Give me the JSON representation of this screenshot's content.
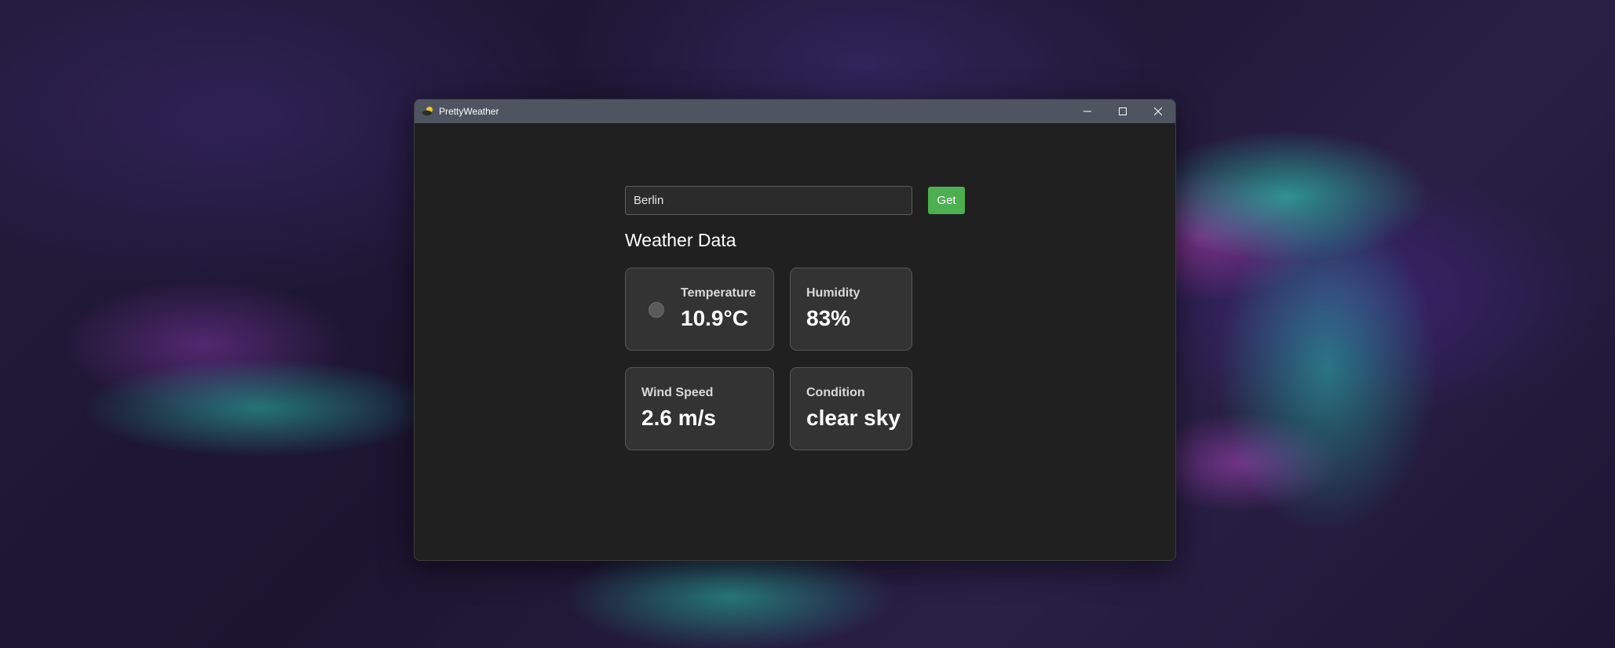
{
  "window": {
    "title": "PrettyWeather",
    "icon": "sun-cloud-icon",
    "controls": [
      "minimize-icon",
      "maximize-icon",
      "close-icon"
    ]
  },
  "search": {
    "value": "Berlin",
    "button_label": "Get"
  },
  "weather": {
    "heading": "Weather Data",
    "temperature": {
      "label": "Temperature",
      "value": "10.9°C",
      "icon": "status-dot-icon"
    },
    "humidity": {
      "label": "Humidity",
      "value": "83%"
    },
    "wind_speed": {
      "label": "Wind Speed",
      "value": "2.6 m/s"
    },
    "condition": {
      "label": "Condition",
      "value": "clear sky"
    }
  },
  "colors": {
    "accent": "#4caf50",
    "titlebar": "#4e5560",
    "window_bg": "#202020",
    "card_bg": "#333333"
  }
}
